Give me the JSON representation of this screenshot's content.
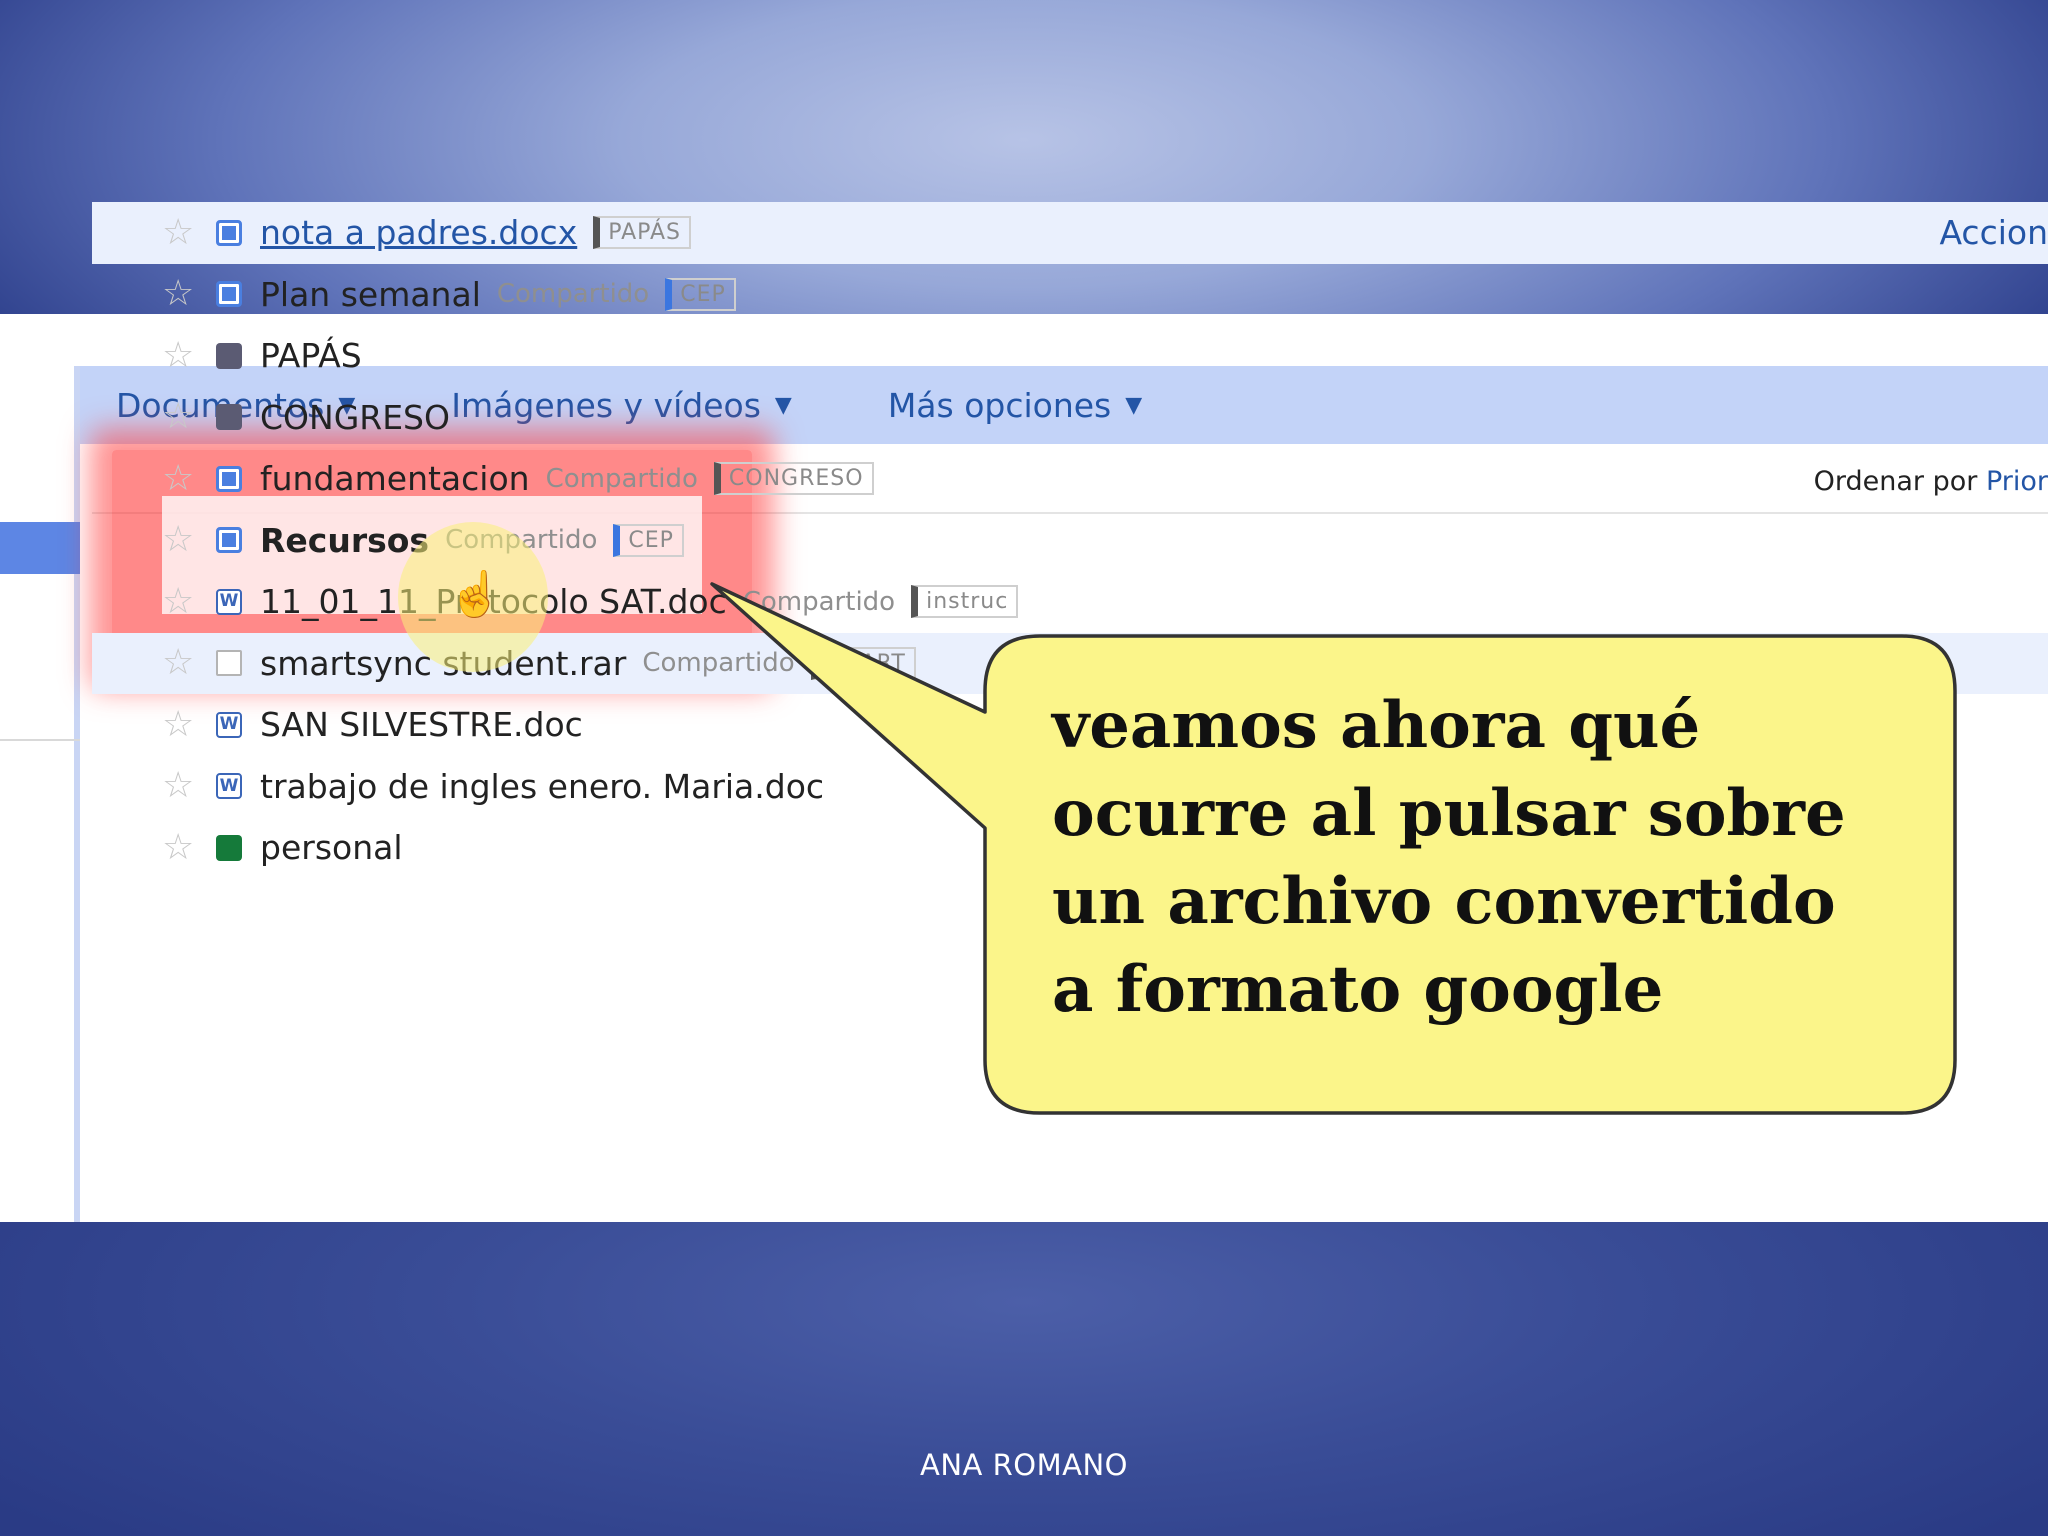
{
  "menubar": {
    "items": [
      {
        "label": "Documentos",
        "caret": "▼"
      },
      {
        "label": "Imágenes y vídeos",
        "caret": "▼"
      },
      {
        "label": "Más opciones",
        "caret": "▼"
      }
    ]
  },
  "sort": {
    "prefix": "Ordenar por",
    "link": "Prior"
  },
  "actions_label": "Accion",
  "files": [
    {
      "name": "nota a padres.docx",
      "tag": "PAPÁS"
    },
    {
      "name": "Plan semanal",
      "shared": "Compartido",
      "tag": "CEP"
    },
    {
      "name": "PAPÁS"
    },
    {
      "name": "CONGRESO"
    },
    {
      "name": "fundamentacion",
      "shared": "Compartido",
      "tag": "CONGRESO"
    },
    {
      "name": "Recursos",
      "shared": "Compartido",
      "tag": "CEP"
    },
    {
      "name": "11_01_11_Protocolo SAT.doc",
      "shared": "Compartido",
      "tag": "instruc"
    },
    {
      "name": "smartsync student.rar",
      "shared": "Compartido",
      "tag": "SMART"
    },
    {
      "name": "SAN SILVESTRE.doc"
    },
    {
      "name": "trabajo de ingles enero. Maria.doc"
    },
    {
      "name": "personal"
    }
  ],
  "callout": {
    "lines": [
      "veamos ahora qué",
      "ocurre al pulsar sobre",
      "un archivo convertido",
      "a formato google"
    ],
    "fill": "#fbf58a",
    "stroke": "#333333"
  },
  "footer": {
    "author": "ANA ROMANO"
  },
  "colors": {
    "highlight": "#ff2828",
    "link": "#2355a6",
    "menubar": "#c3d3f8"
  }
}
